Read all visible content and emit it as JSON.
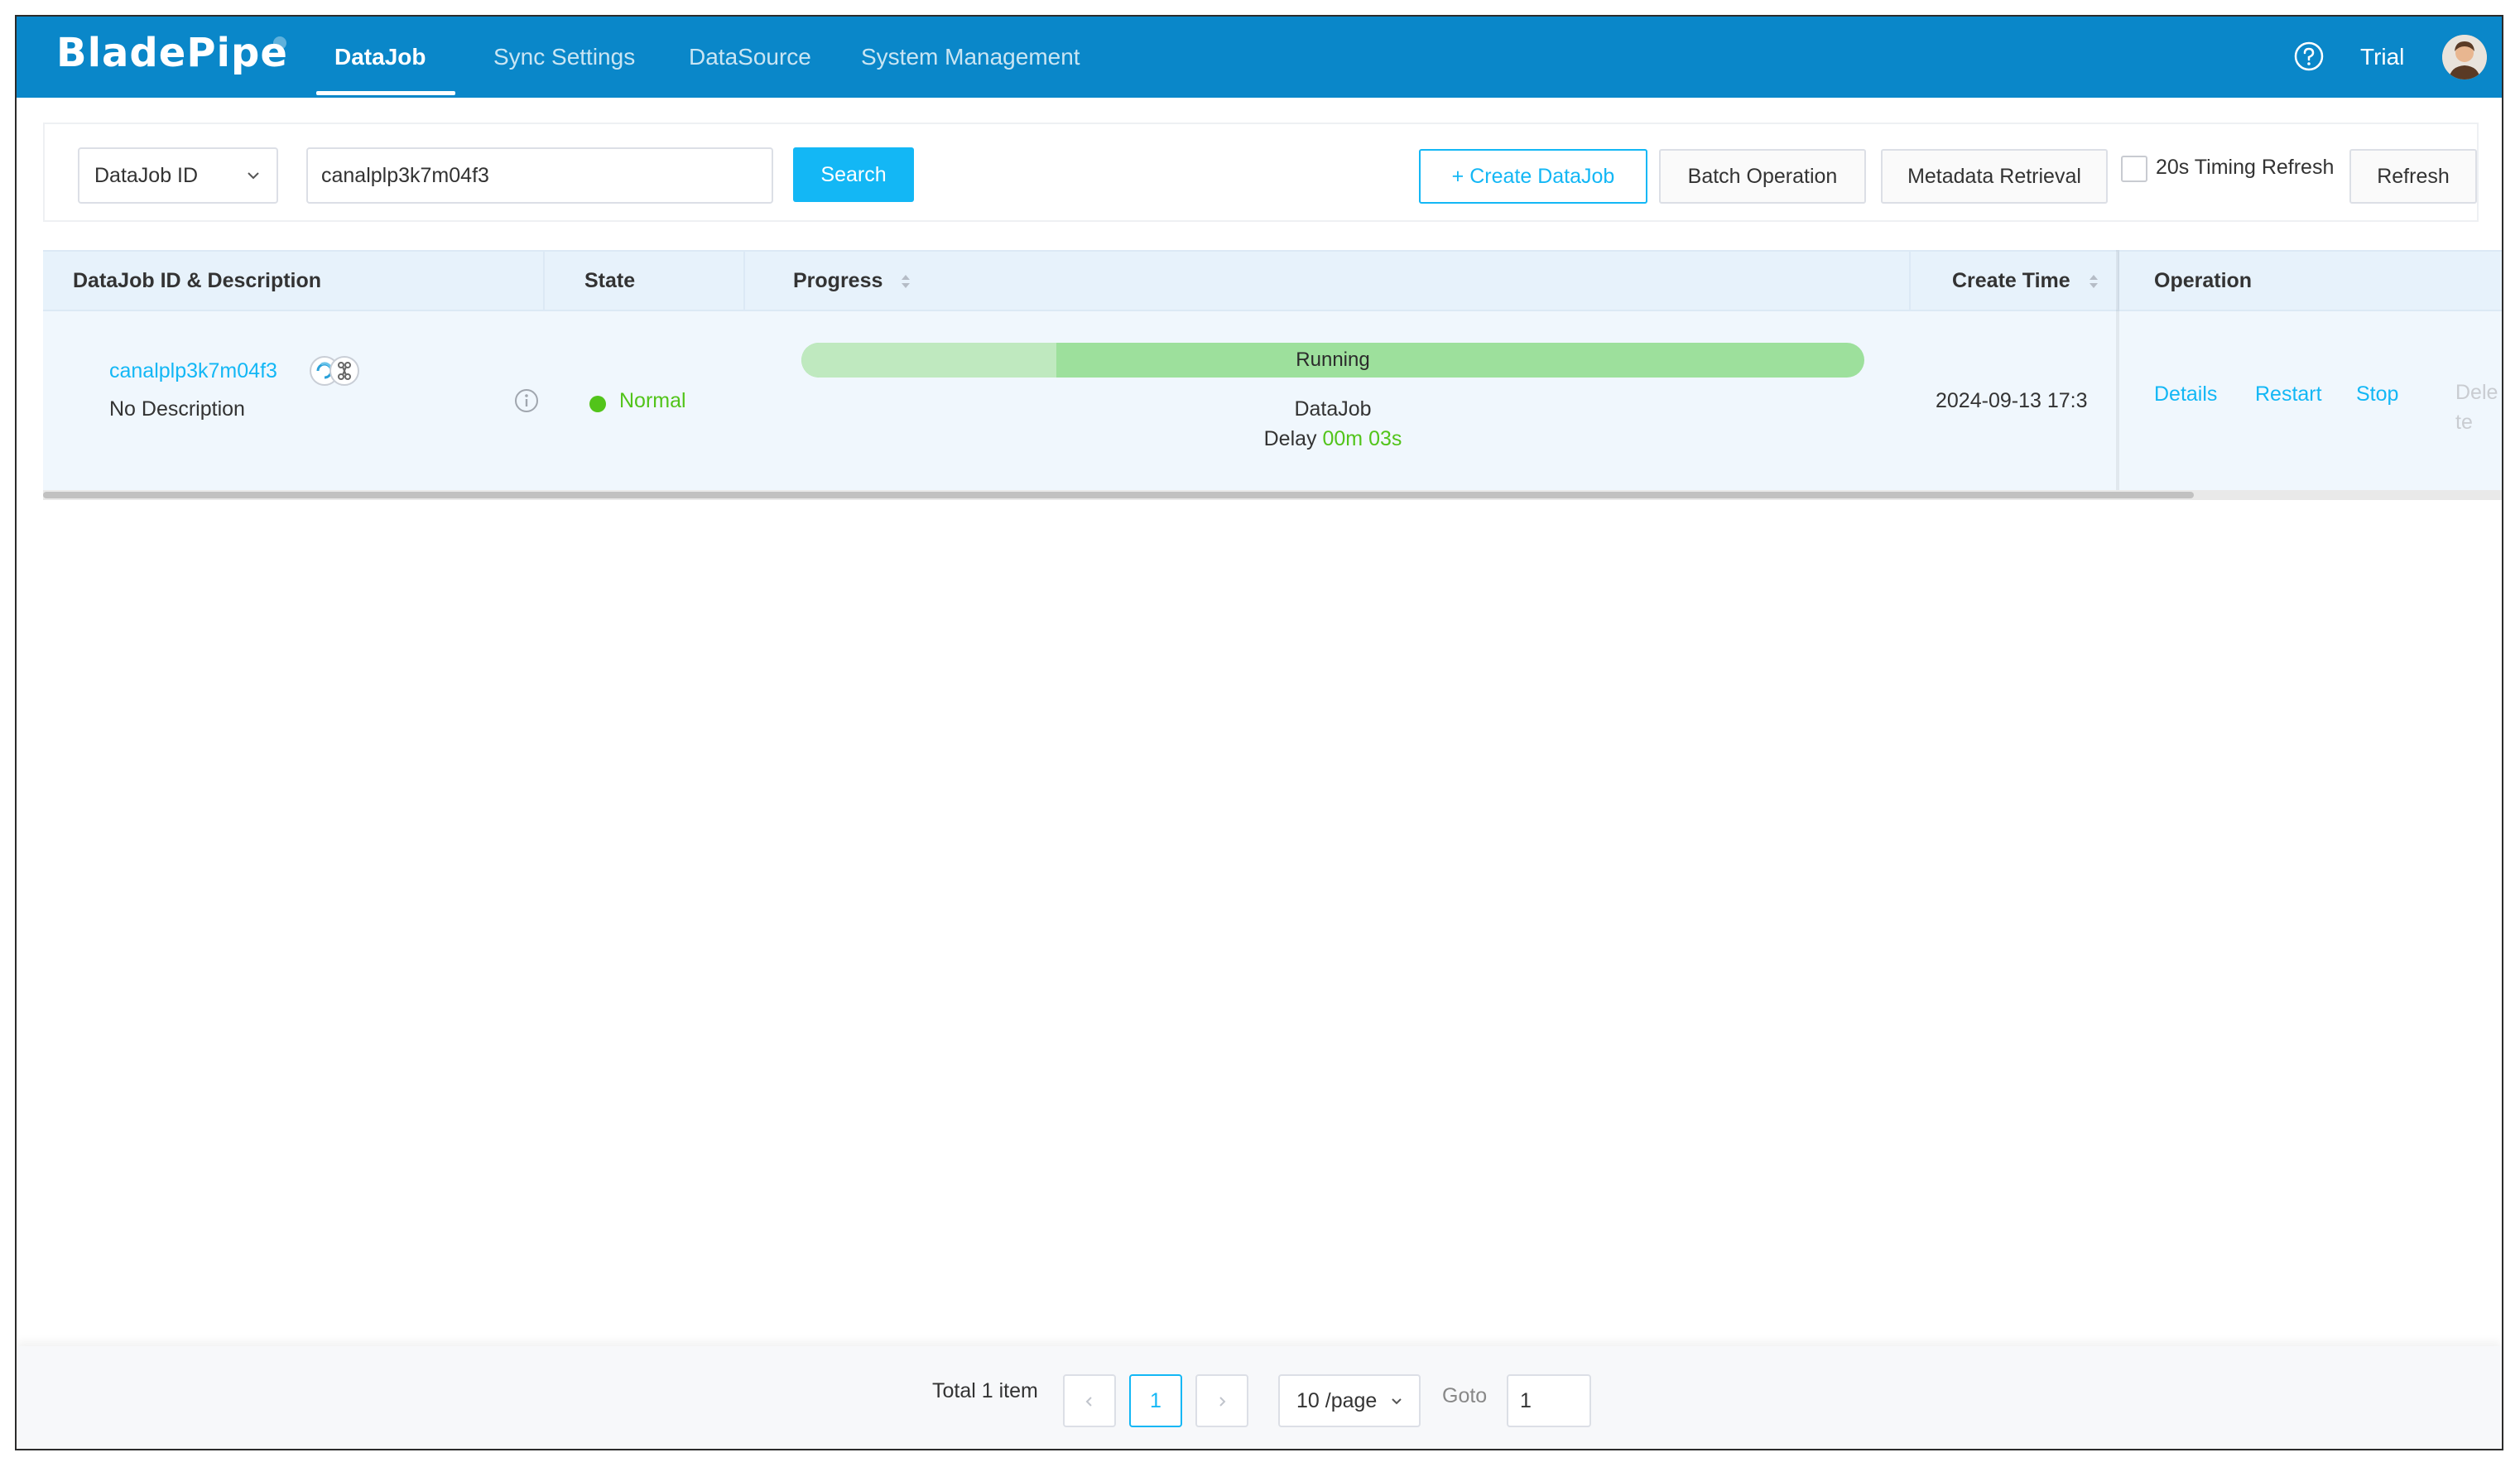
{
  "header": {
    "logo": "BladePipe",
    "tabs": [
      {
        "label": "DataJob",
        "active": true
      },
      {
        "label": "Sync Settings",
        "active": false
      },
      {
        "label": "DataSource",
        "active": false
      },
      {
        "label": "System Management",
        "active": false
      }
    ],
    "help_icon": "question-circle-icon",
    "user_label": "Trial",
    "avatar_icon": "user-avatar"
  },
  "filter": {
    "field_select": "DataJob ID",
    "search_value": "canalplp3k7m04f3",
    "search_button": "Search",
    "create_button": "+ Create DataJob",
    "batch_button": "Batch Operation",
    "metadata_button": "Metadata Retrieval",
    "timing_refresh_label": "20s Timing Refresh",
    "timing_refresh_checked": false,
    "refresh_button": "Refresh"
  },
  "table": {
    "columns": [
      "DataJob ID & Description",
      "State",
      "Progress",
      "Create Time",
      "Operation"
    ],
    "rows": [
      {
        "id": "canalplp3k7m04f3",
        "description": "No Description",
        "state": "Normal",
        "progress_status": "Running",
        "progress_fraction": 0.24,
        "job_type": "DataJob",
        "delay_label": "Delay",
        "delay_value": "00m 03s",
        "create_time": "2024-09-13 17:3",
        "operations": {
          "details": "Details",
          "restart": "Restart",
          "stop": "Stop",
          "delete": "Delete"
        }
      }
    ]
  },
  "pagination": {
    "total_label": "Total 1 item",
    "current_page": "1",
    "page_size": "10 /page",
    "goto_label": "Goto",
    "goto_value": "1"
  },
  "colors": {
    "header_bg": "#0a87c9",
    "accent": "#13b7f5",
    "success": "#52c41a",
    "progress": "#9de09c"
  }
}
